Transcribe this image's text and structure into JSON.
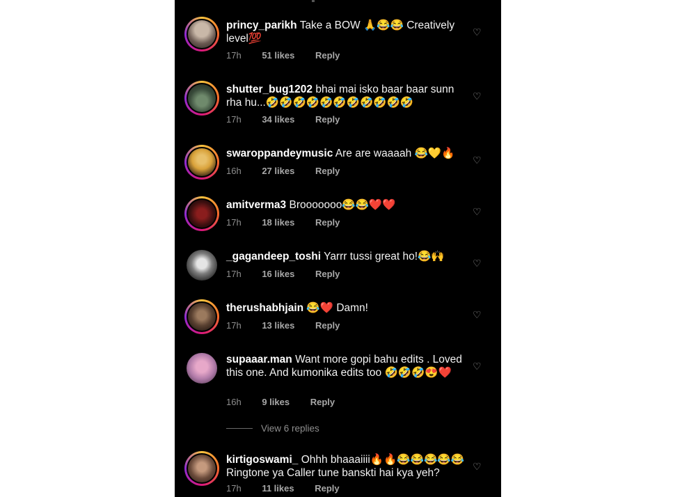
{
  "comments": [
    {
      "user": "princy_parikh",
      "text": "Take a BOW 🙏😂😂 Creatively level💯",
      "time": "17h",
      "likes": "51 likes",
      "reply": "Reply"
    },
    {
      "user": "shutter_bug1202",
      "text": "bhai mai isko baar baar sunn rha hu...🤣🤣🤣🤣🤣🤣🤣🤣🤣🤣🤣",
      "time": "17h",
      "likes": "34 likes",
      "reply": "Reply"
    },
    {
      "user": "swaroppandeymusic",
      "text": "Are are waaaah 😂💛🔥",
      "time": "16h",
      "likes": "27 likes",
      "reply": "Reply"
    },
    {
      "user": "amitverma3",
      "text": "Brooooooo😂😂❤️❤️",
      "time": "17h",
      "likes": "18 likes",
      "reply": "Reply"
    },
    {
      "user": "_gagandeep_toshi",
      "text": "Yarrr tussi great ho!😂🙌",
      "time": "17h",
      "likes": "16 likes",
      "reply": "Reply"
    },
    {
      "user": "therushabhjain",
      "text": "😂❤️ Damn!",
      "time": "17h",
      "likes": "13 likes",
      "reply": "Reply"
    },
    {
      "user": "supaaar.man",
      "text": "Want more gopi bahu edits . Loved this one. And kumonika edits too 🤣🤣🤣😍❤️",
      "time": "16h",
      "likes": "9 likes",
      "reply": "Reply"
    },
    {
      "user": "kirtigoswami_",
      "text": "Ohhh bhaaaiiii🔥🔥😂😂😂😂😂 Ringtone ya Caller tune banskti hai kya yeh?",
      "time": "17h",
      "likes": "11 likes",
      "reply": "Reply"
    }
  ],
  "view_replies": "View 6 replies",
  "icons": {
    "like": "heart-outline-icon"
  }
}
